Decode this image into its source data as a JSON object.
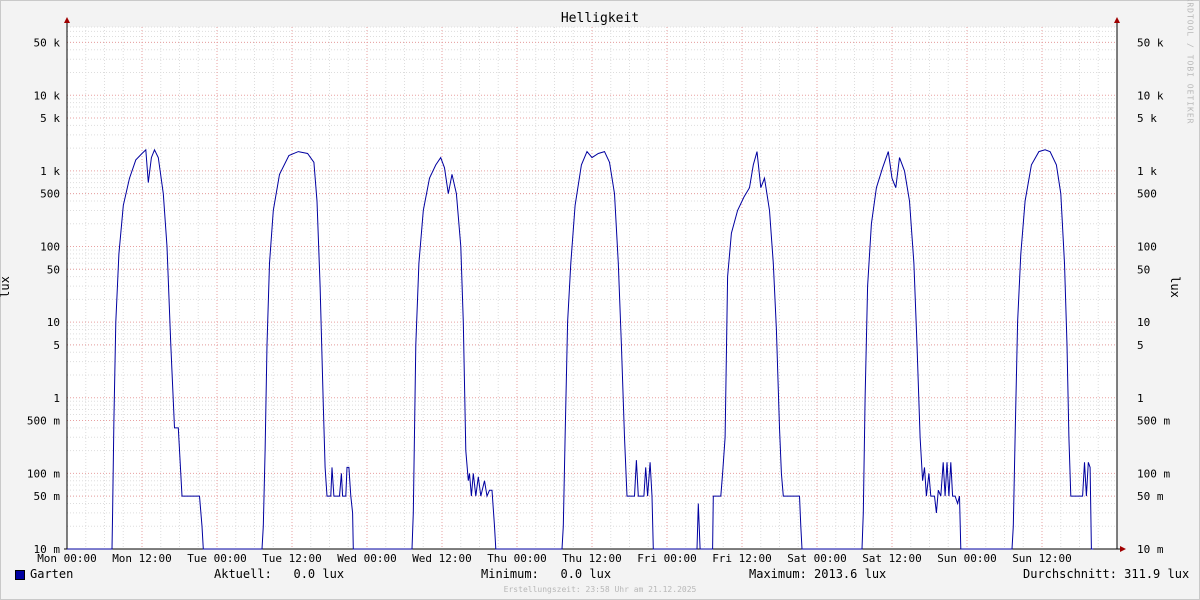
{
  "watermark": "RRDTOOL / TOBI OETIKER",
  "chart_data": {
    "type": "line",
    "title": "Helligkeit",
    "ylabel": "lux",
    "yscale": "log",
    "ylim": [
      0.01,
      80000
    ],
    "y_tick_values": [
      0.01,
      0.05,
      0.1,
      0.5,
      1,
      5,
      10,
      50,
      100,
      500,
      1000,
      5000,
      10000,
      50000
    ],
    "y_tick_labels": [
      "10 m",
      "50 m",
      "100 m",
      "500 m",
      "1",
      "5",
      "10",
      "50",
      "100",
      "500",
      "1 k",
      "5 k",
      "10 k",
      "50 k"
    ],
    "xlim_hours": [
      0,
      168
    ],
    "x_tick_hours": [
      0,
      12,
      24,
      36,
      48,
      60,
      72,
      84,
      96,
      108,
      120,
      132,
      144,
      156
    ],
    "x_tick_labels": [
      "Mon 00:00",
      "Mon 12:00",
      "Tue 00:00",
      "Tue 12:00",
      "Wed 00:00",
      "Wed 12:00",
      "Thu 00:00",
      "Thu 12:00",
      "Fri 00:00",
      "Fri 12:00",
      "Sat 00:00",
      "Sat 12:00",
      "Sun 00:00",
      "Sun 12:00"
    ],
    "grid": true,
    "series": [
      {
        "name": "Garten",
        "color": "#0000a0",
        "points": [
          [
            0,
            0.01
          ],
          [
            7.2,
            0.01
          ],
          [
            7.3,
            0.03
          ],
          [
            7.5,
            0.5
          ],
          [
            7.8,
            10
          ],
          [
            8.3,
            80
          ],
          [
            9,
            350
          ],
          [
            10,
            800
          ],
          [
            11,
            1400
          ],
          [
            12,
            1700
          ],
          [
            12.6,
            1900
          ],
          [
            13,
            700
          ],
          [
            13.5,
            1500
          ],
          [
            14,
            1900
          ],
          [
            14.6,
            1500
          ],
          [
            15.4,
            500
          ],
          [
            16,
            100
          ],
          [
            16.6,
            5
          ],
          [
            17.2,
            0.4
          ],
          [
            17.8,
            0.4
          ],
          [
            18.4,
            0.05
          ],
          [
            21.2,
            0.05
          ],
          [
            21.6,
            0.02
          ],
          [
            21.8,
            0.01
          ],
          [
            31.2,
            0.01
          ],
          [
            31.4,
            0.02
          ],
          [
            31.7,
            0.2
          ],
          [
            32,
            5
          ],
          [
            32.4,
            60
          ],
          [
            33,
            300
          ],
          [
            34,
            900
          ],
          [
            35.5,
            1600
          ],
          [
            37,
            1800
          ],
          [
            38.5,
            1700
          ],
          [
            39.5,
            1300
          ],
          [
            40,
            400
          ],
          [
            40.5,
            30
          ],
          [
            41,
            0.8
          ],
          [
            41.3,
            0.12
          ],
          [
            41.6,
            0.05
          ],
          [
            42.2,
            0.05
          ],
          [
            42.4,
            0.12
          ],
          [
            42.7,
            0.05
          ],
          [
            43.6,
            0.05
          ],
          [
            43.9,
            0.1
          ],
          [
            44.1,
            0.05
          ],
          [
            44.6,
            0.05
          ],
          [
            44.8,
            0.12
          ],
          [
            45.1,
            0.12
          ],
          [
            45.4,
            0.05
          ],
          [
            45.7,
            0.03
          ],
          [
            45.8,
            0.01
          ],
          [
            55.2,
            0.01
          ],
          [
            55.4,
            0.03
          ],
          [
            55.8,
            5
          ],
          [
            56.3,
            60
          ],
          [
            57,
            300
          ],
          [
            58,
            800
          ],
          [
            59,
            1200
          ],
          [
            59.8,
            1500
          ],
          [
            60.4,
            1100
          ],
          [
            61,
            500
          ],
          [
            61.6,
            900
          ],
          [
            62.3,
            500
          ],
          [
            63,
            100
          ],
          [
            63.4,
            10
          ],
          [
            63.8,
            0.2
          ],
          [
            64.2,
            0.08
          ],
          [
            64.4,
            0.1
          ],
          [
            64.7,
            0.05
          ],
          [
            65,
            0.1
          ],
          [
            65.4,
            0.05
          ],
          [
            65.8,
            0.09
          ],
          [
            66.2,
            0.05
          ],
          [
            66.8,
            0.08
          ],
          [
            67.2,
            0.05
          ],
          [
            67.6,
            0.06
          ],
          [
            68,
            0.06
          ],
          [
            68.4,
            0.02
          ],
          [
            68.6,
            0.01
          ],
          [
            79.2,
            0.01
          ],
          [
            79.4,
            0.02
          ],
          [
            79.7,
            0.3
          ],
          [
            80.1,
            10
          ],
          [
            80.6,
            60
          ],
          [
            81.3,
            350
          ],
          [
            82.3,
            1200
          ],
          [
            83.2,
            1800
          ],
          [
            84,
            1500
          ],
          [
            85,
            1700
          ],
          [
            86,
            1800
          ],
          [
            86.8,
            1300
          ],
          [
            87.6,
            500
          ],
          [
            88.2,
            60
          ],
          [
            88.7,
            5
          ],
          [
            89.2,
            0.3
          ],
          [
            89.6,
            0.05
          ],
          [
            90.8,
            0.05
          ],
          [
            91.1,
            0.15
          ],
          [
            91.4,
            0.05
          ],
          [
            92.3,
            0.05
          ],
          [
            92.6,
            0.12
          ],
          [
            92.9,
            0.05
          ],
          [
            93.3,
            0.14
          ],
          [
            93.6,
            0.05
          ],
          [
            93.8,
            0.01
          ],
          [
            100.8,
            0.01
          ],
          [
            101,
            0.04
          ],
          [
            101.3,
            0.01
          ],
          [
            103.3,
            0.01
          ],
          [
            103.4,
            0.05
          ],
          [
            104.6,
            0.05
          ],
          [
            104.9,
            0.1
          ],
          [
            105.3,
            0.3
          ],
          [
            105.7,
            40
          ],
          [
            106.3,
            150
          ],
          [
            107.3,
            300
          ],
          [
            108.3,
            450
          ],
          [
            109.2,
            600
          ],
          [
            109.8,
            1200
          ],
          [
            110.4,
            1800
          ],
          [
            111,
            600
          ],
          [
            111.6,
            800
          ],
          [
            112.4,
            300
          ],
          [
            113,
            60
          ],
          [
            113.5,
            8
          ],
          [
            114,
            0.4
          ],
          [
            114.3,
            0.1
          ],
          [
            114.6,
            0.05
          ],
          [
            117.2,
            0.05
          ],
          [
            117.4,
            0.02
          ],
          [
            117.6,
            0.01
          ],
          [
            127.2,
            0.01
          ],
          [
            127.4,
            0.03
          ],
          [
            127.7,
            1
          ],
          [
            128.1,
            30
          ],
          [
            128.7,
            200
          ],
          [
            129.5,
            600
          ],
          [
            130.5,
            1100
          ],
          [
            131.4,
            1800
          ],
          [
            132,
            800
          ],
          [
            132.6,
            600
          ],
          [
            133.2,
            1500
          ],
          [
            134,
            1000
          ],
          [
            134.8,
            400
          ],
          [
            135.5,
            60
          ],
          [
            136,
            5
          ],
          [
            136.5,
            0.3
          ],
          [
            136.9,
            0.08
          ],
          [
            137.2,
            0.12
          ],
          [
            137.5,
            0.05
          ],
          [
            137.9,
            0.1
          ],
          [
            138.2,
            0.05
          ],
          [
            138.8,
            0.05
          ],
          [
            139.1,
            0.03
          ],
          [
            139.4,
            0.06
          ],
          [
            139.8,
            0.05
          ],
          [
            140.2,
            0.14
          ],
          [
            140.5,
            0.05
          ],
          [
            140.8,
            0.14
          ],
          [
            141.1,
            0.05
          ],
          [
            141.4,
            0.14
          ],
          [
            141.7,
            0.05
          ],
          [
            142.1,
            0.05
          ],
          [
            142.5,
            0.04
          ],
          [
            142.8,
            0.05
          ],
          [
            143,
            0.01
          ],
          [
            151.2,
            0.01
          ],
          [
            151.4,
            0.02
          ],
          [
            151.7,
            0.3
          ],
          [
            152.1,
            10
          ],
          [
            152.6,
            80
          ],
          [
            153.3,
            400
          ],
          [
            154.3,
            1200
          ],
          [
            155.5,
            1800
          ],
          [
            156.5,
            1900
          ],
          [
            157.3,
            1800
          ],
          [
            158.3,
            1200
          ],
          [
            159,
            500
          ],
          [
            159.6,
            60
          ],
          [
            160,
            5
          ],
          [
            160.3,
            0.3
          ],
          [
            160.6,
            0.05
          ],
          [
            162.5,
            0.05
          ],
          [
            162.8,
            0.14
          ],
          [
            163.1,
            0.05
          ],
          [
            163.4,
            0.14
          ],
          [
            163.7,
            0.12
          ],
          [
            163.9,
            0.01
          ],
          [
            164.2,
            0.01
          ]
        ]
      }
    ]
  },
  "legend": {
    "series": "Garten",
    "current": "Aktuell:   0.0 lux",
    "min": "Minimum:   0.0 lux",
    "max": "Maximum: 2013.6 lux",
    "avg": "Durchschnitt: 311.9 lux"
  },
  "footer": "Erstellungszeit: 23:58 Uhr am 21.12.2025"
}
